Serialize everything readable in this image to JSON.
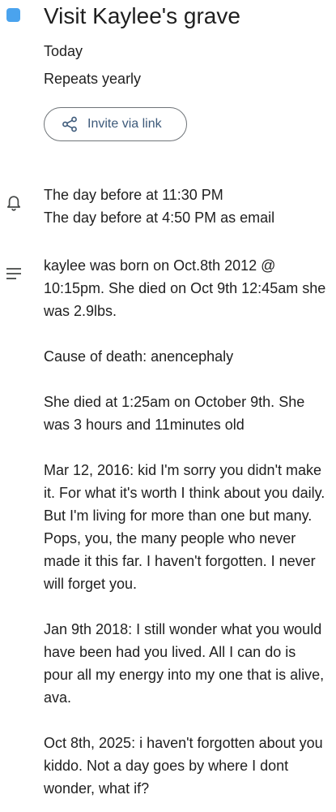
{
  "event": {
    "title": "Visit Kaylee's grave",
    "color": "#4aa3ee",
    "date": "Today",
    "recurrence": "Repeats yearly",
    "invite_label": "Invite via link"
  },
  "notifications": [
    "The day before at 11:30 PM",
    "The day before at 4:50 PM as email"
  ],
  "description": {
    "paragraphs": [
      "kaylee was born on Oct.8th 2012 @ 10:15pm. She died on Oct 9th 12:45am she was 2.9lbs.",
      "Cause of death: anencephaly",
      "She died at 1:25am on October 9th. She was 3 hours and 11minutes old",
      "Mar 12, 2016: kid I'm sorry you didn't make it. For what it's worth I think about you daily. But I'm living for more than one but many. Pops, you, the many people who never made it this far. I haven't forgotten. I never will forget you.",
      "Jan 9th 2018: I still wonder what you would have been had you lived. All I can do is pour all my energy into my one that is alive, ava.",
      "Oct 8th, 2025: i haven't forgotten about you kiddo. Not a day goes by where I dont wonder, what if?"
    ]
  },
  "icons": {
    "share": "share-icon",
    "bell": "bell-icon",
    "notes": "notes-icon"
  }
}
